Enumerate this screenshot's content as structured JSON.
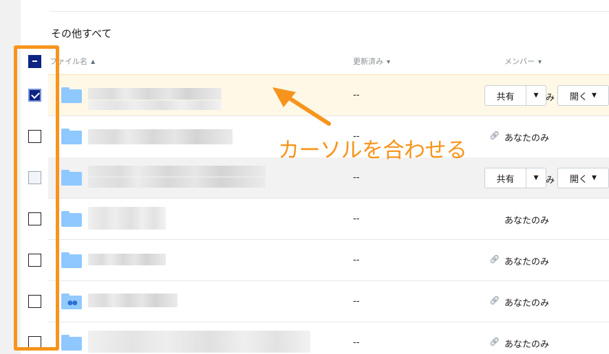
{
  "section": {
    "title": "その他すべて"
  },
  "columns": {
    "name": "ファイル名",
    "modified": "更新済み",
    "members": "メンバー"
  },
  "row_actions": {
    "share_label": "共有",
    "open_label": "開く",
    "member_cut": "み"
  },
  "rows": [
    {
      "modified": "--",
      "member": "",
      "checked": true,
      "hover": "yellow"
    },
    {
      "modified": "--",
      "member": "あなたのみ",
      "checked": false,
      "hover": ""
    },
    {
      "modified": "--",
      "member": "",
      "checked": false,
      "hover": "gray"
    },
    {
      "modified": "--",
      "member": "あなたのみ",
      "checked": false,
      "hover": ""
    },
    {
      "modified": "--",
      "member": "あなたのみ",
      "checked": false,
      "hover": ""
    },
    {
      "modified": "--",
      "member": "あなたのみ",
      "checked": false,
      "hover": ""
    },
    {
      "modified": "--",
      "member": "あなたのみ",
      "checked": false,
      "hover": ""
    }
  ],
  "annotation": {
    "text": "カーソルを合わせる",
    "color": "#f7941d"
  },
  "icons": {
    "folder": "folder-icon",
    "shared_folder": "shared-folder-icon",
    "link": "link-icon",
    "sort_up": "arrow-up-icon",
    "caret": "caret-down-icon"
  },
  "colors": {
    "accent": "#0d2481",
    "folder": "#8fc8ff",
    "highlight": "#f7941d",
    "hover_row": "#fff8e6"
  }
}
